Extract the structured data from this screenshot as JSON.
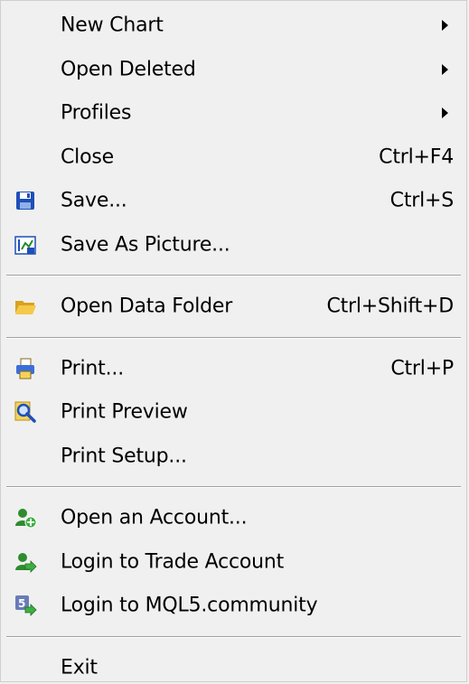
{
  "menu": {
    "items": [
      {
        "label": "New Chart",
        "submenu": true,
        "icon": null
      },
      {
        "label": "Open Deleted",
        "submenu": true,
        "icon": null
      },
      {
        "label": "Profiles",
        "submenu": true,
        "icon": null
      },
      {
        "label": "Close",
        "shortcut": "Ctrl+F4",
        "icon": null
      },
      {
        "label": "Save...",
        "shortcut": "Ctrl+S",
        "icon": "save-floppy-icon"
      },
      {
        "label": "Save As Picture...",
        "icon": "save-picture-icon"
      },
      {
        "label": "Open Data Folder",
        "shortcut": "Ctrl+Shift+D",
        "icon": "folder-open-icon"
      },
      {
        "label": "Print...",
        "shortcut": "Ctrl+P",
        "icon": "printer-icon"
      },
      {
        "label": "Print Preview",
        "icon": "print-preview-magnifier-icon"
      },
      {
        "label": "Print Setup...",
        "icon": null
      },
      {
        "label": "Open an Account...",
        "icon": "open-account-user-icon"
      },
      {
        "label": "Login to Trade Account",
        "icon": "login-trade-user-icon"
      },
      {
        "label": "Login to MQL5.community",
        "icon": "login-mql5-icon"
      },
      {
        "label": "Exit",
        "icon": null
      }
    ]
  },
  "colors": {
    "background": "#f0f0f0",
    "separator": "#a0a0a0",
    "text": "#000000"
  }
}
